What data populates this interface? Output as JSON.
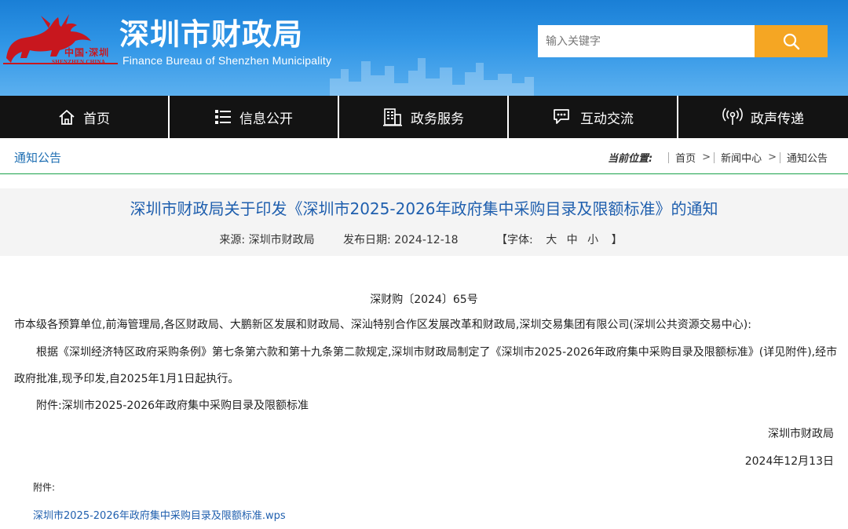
{
  "header": {
    "logo_cn": "中国·深圳",
    "logo_en": "SHENZHEN CHINA",
    "title": "深圳市财政局",
    "subtitle": "Finance Bureau of Shenzhen Municipality",
    "search_placeholder": "输入关键字",
    "search_icon": "search-icon",
    "accent_color": "#f5a623"
  },
  "nav": {
    "items": [
      {
        "label": "首页",
        "icon": "home-icon"
      },
      {
        "label": "信息公开",
        "icon": "list-icon"
      },
      {
        "label": "政务服务",
        "icon": "building-icon"
      },
      {
        "label": "互动交流",
        "icon": "chat-icon"
      },
      {
        "label": "政声传递",
        "icon": "broadcast-icon"
      }
    ]
  },
  "breadcrumb": {
    "section": "通知公告",
    "location_label": "当前位置:",
    "items": [
      "首页",
      "新闻中心",
      "通知公告"
    ],
    "separator": ">"
  },
  "article": {
    "title": "深圳市财政局关于印发《深圳市2025-2026年政府集中采购目录及限额标准》的通知",
    "source": "来源:  深圳市财政局",
    "date": "发布日期:  2024-12-18",
    "font_open": "【字体:",
    "font_large": "大",
    "font_medium": "中",
    "font_small": "小",
    "font_close": "】",
    "doc_number": "深财购〔2024〕65号",
    "salutation": "市本级各预算单位,前海管理局,各区财政局、大鹏新区发展和财政局、深汕特别合作区发展改革和财政局,深圳交易集团有限公司(深圳公共资源交易中心):",
    "body": "根据《深圳经济特区政府采购条例》第七条第六款和第十九条第二款规定,深圳市财政局制定了《深圳市2025-2026年政府集中采购目录及限额标准》(详见附件),经市政府批准,现予印发,自2025年1月1日起执行。",
    "attachment_line": "附件:深圳市2025-2026年政府集中采购目录及限额标准",
    "sign_org": "深圳市财政局",
    "sign_date": "2024年12月13日",
    "attachments_label": "附件:",
    "attachment_file": "深圳市2025-2026年政府集中采购目录及限额标准.wps"
  }
}
